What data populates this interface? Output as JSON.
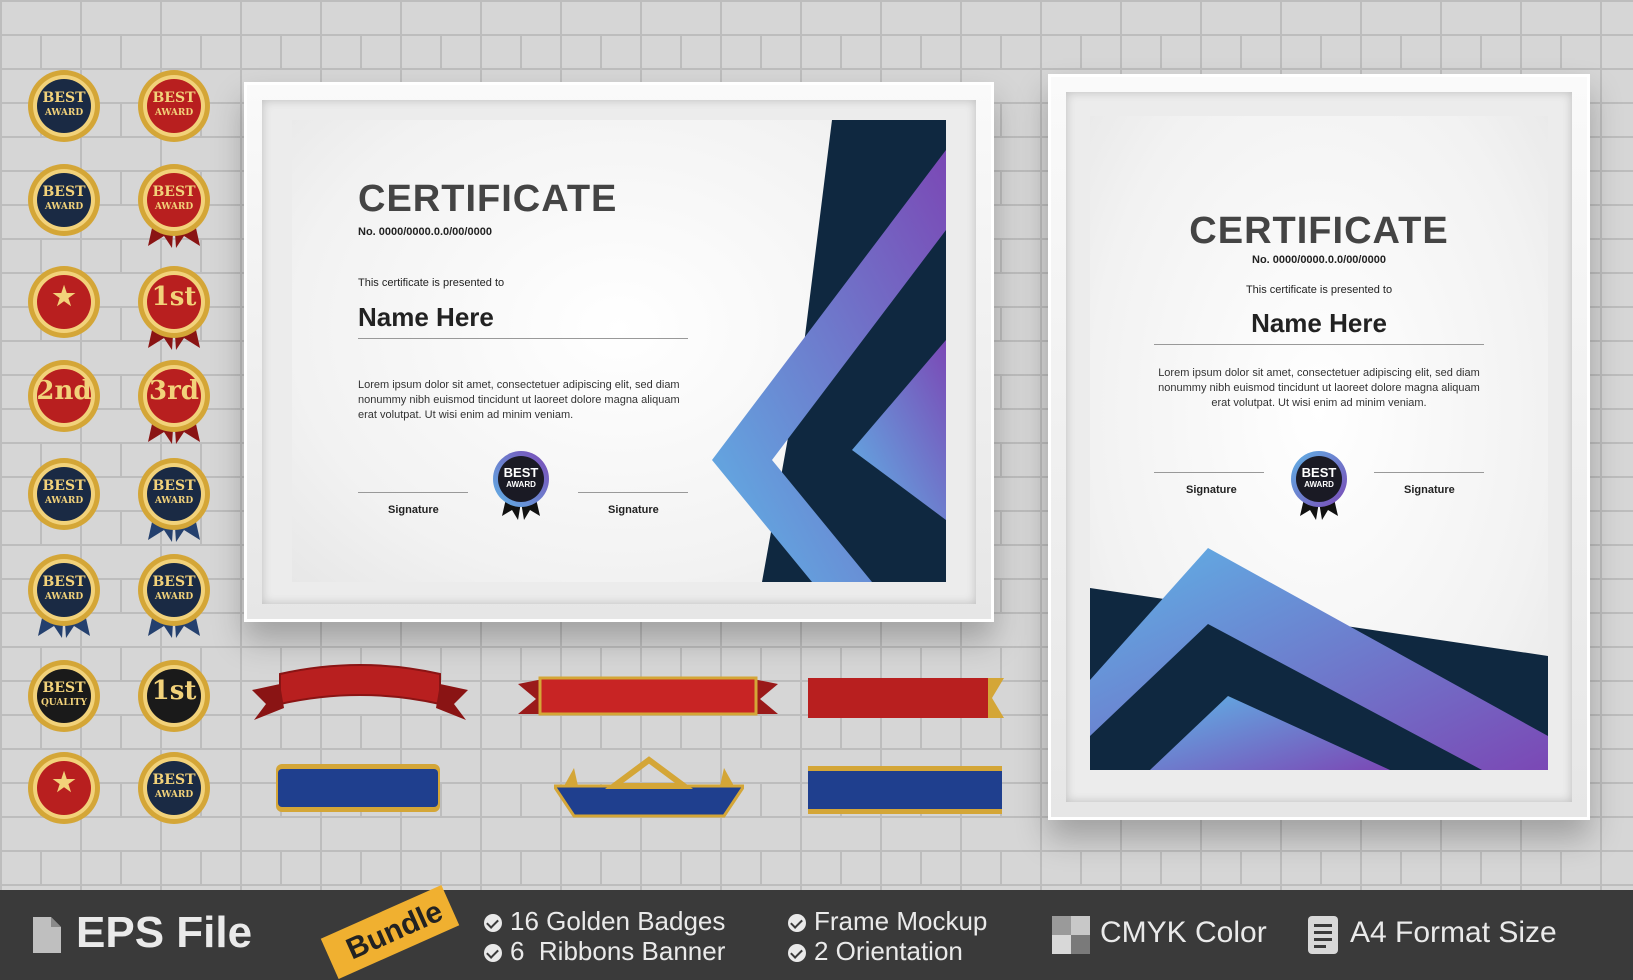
{
  "certificates": {
    "landscape": {
      "title": "CERTIFICATE",
      "number": "No. 0000/0000.0.0/00/0000",
      "presented": "This certificate is presented to",
      "name": "Name Here",
      "body": "Lorem ipsum dolor sit amet, consectetuer adipiscing elit, sed diam nonummy nibh euismod tincidunt ut laoreet dolore magna aliquam erat volutpat. Ut wisi enim ad minim veniam.",
      "signature_left": "Signature",
      "signature_right": "Signature",
      "seal_line1": "BEST",
      "seal_line2": "AWARD"
    },
    "portrait": {
      "title": "CERTIFICATE",
      "number": "No. 0000/0000.0.0/00/0000",
      "presented": "This certificate is presented to",
      "name": "Name Here",
      "body": "Lorem ipsum dolor sit amet, consectetuer adipiscing elit, sed diam nonummy nibh euismod tincidunt ut laoreet dolore magna aliquam erat volutpat. Ut wisi enim ad minim veniam.",
      "signature_left": "Signature",
      "signature_right": "Signature",
      "seal_line1": "BEST",
      "seal_line2": "AWARD"
    }
  },
  "badges": [
    {
      "text1": "BEST",
      "text2": "AWARD"
    },
    {
      "text1": "BEST",
      "text2": "AWARD"
    },
    {
      "text1": "BEST",
      "text2": "AWARD"
    },
    {
      "text1": "BEST",
      "text2": "AWARD"
    },
    {
      "text1": "★",
      "text2": ""
    },
    {
      "text1": "1st",
      "text2": ""
    },
    {
      "text1": "2nd",
      "text2": ""
    },
    {
      "text1": "3rd",
      "text2": ""
    },
    {
      "text1": "BEST",
      "text2": "AWARD"
    },
    {
      "text1": "BEST",
      "text2": "AWARD"
    },
    {
      "text1": "BEST",
      "text2": "AWARD"
    },
    {
      "text1": "BEST",
      "text2": "AWARD"
    },
    {
      "text1": "BEST",
      "text2": "QUALITY"
    },
    {
      "text1": "1st",
      "text2": ""
    },
    {
      "text1": "★",
      "text2": ""
    },
    {
      "text1": "BEST",
      "text2": "AWARD"
    }
  ],
  "bottom_bar": {
    "file_label": "EPS File",
    "bundle_label": "Bundle",
    "features": [
      "16 Golden Badges",
      "6  Ribbons Banner",
      "Frame Mockup",
      "2 Orientation"
    ],
    "cmyk_label": "CMYK Color",
    "format_label": "A4 Format Size"
  },
  "colors": {
    "navy": "#0f2840",
    "purple": "#7b4fb4",
    "blue": "#5fa8e0",
    "gold": "#d4a637",
    "red": "#b81f1f",
    "bar": "#3a3a3a",
    "bundle_tag": "#f0b030"
  }
}
